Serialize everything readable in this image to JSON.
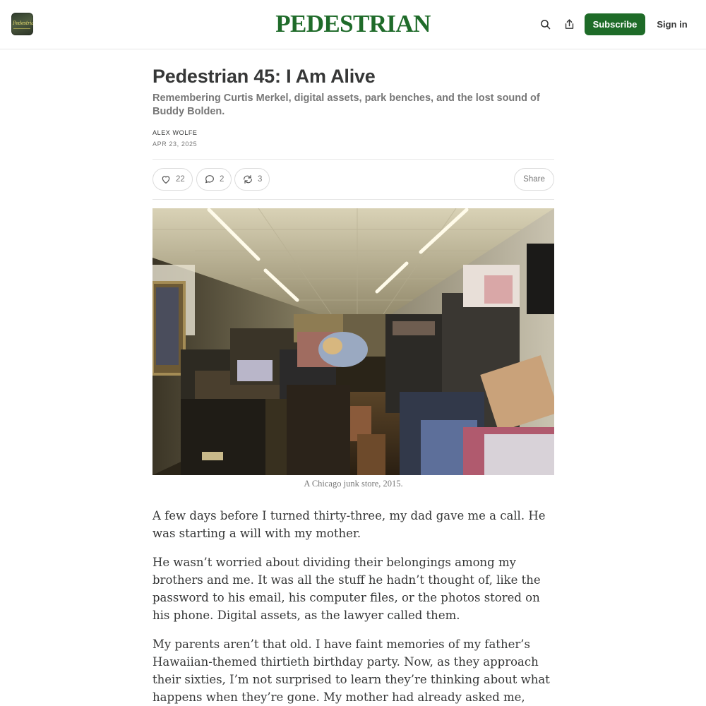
{
  "header": {
    "publication_name": "PEDESTRIAN",
    "logo_text": "Pedestrian",
    "subscribe_label": "Subscribe",
    "signin_label": "Sign in",
    "brand_color": "#1e6b28",
    "icons": [
      "search-icon",
      "share-icon"
    ]
  },
  "post": {
    "title": "Pedestrian 45: I Am Alive",
    "subtitle": "Remembering Curtis Merkel, digital assets, park benches, and the lost sound of Buddy Bolden.",
    "author": "ALEX WOLFE",
    "date": "APR 23, 2025",
    "likes": "22",
    "comments": "2",
    "restacks": "3",
    "share_label": "Share",
    "image_caption": "A Chicago junk store, 2015.",
    "paragraphs": [
      "A few days before I turned thirty-three, my dad gave me a call. He was starting a will with my mother.",
      "He wasn’t worried about dividing their belongings among my brothers and me. It was all the stuff he hadn’t thought of, like the password to his email, his computer files, or the photos stored on his phone. Digital assets, as the lawyer called them.",
      "My parents aren’t that old. I have faint memories of my father’s Hawaiian-themed thirtieth birthday party. Now, as they approach their sixties, I’m not surprised to learn they’re thinking about what happens when they’re gone. My mother had already asked me, several years ago via text, to be her legacy"
    ]
  }
}
